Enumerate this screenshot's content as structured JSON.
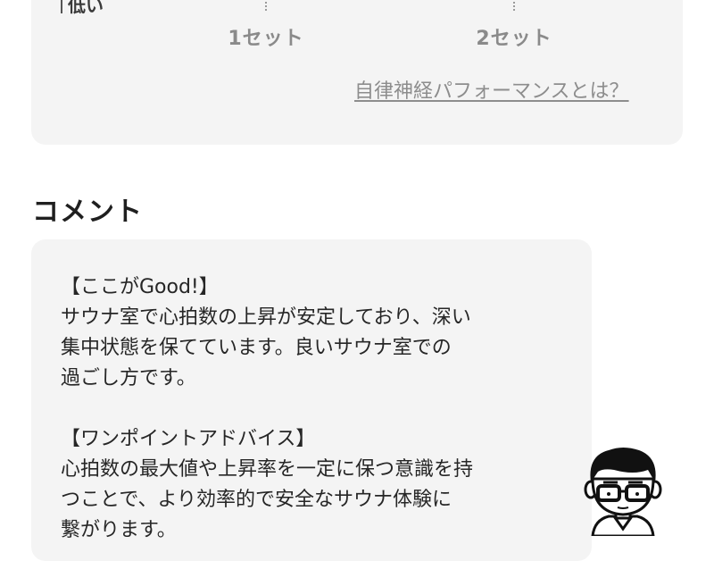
{
  "performance_chart": {
    "low_label": "低い",
    "set_labels": [
      "1セット",
      "2セット"
    ],
    "info_link": "自律神経パフォーマンスとは？"
  },
  "comment": {
    "section_title": "コメント",
    "good_heading": "【ここがGood!】",
    "good_lines": [
      "サウナ室で心拍数の上昇が安定しており、深い",
      "集中状態を保てています。良いサウナ室での",
      "過ごし方です。"
    ],
    "advice_heading": "【ワンポイントアドバイス】",
    "advice_lines": [
      "心拍数の最大値や上昇率を一定に保つ意識を持",
      "つことで、より効率的で安全なサウナ体験に",
      "繋がります。"
    ]
  },
  "icons": {
    "avatar": "man-with-glasses-avatar-icon"
  },
  "colors": {
    "card_bg": "#f4f4f4",
    "muted_text": "#8a8a8a",
    "heading": "#1f1f1f"
  }
}
